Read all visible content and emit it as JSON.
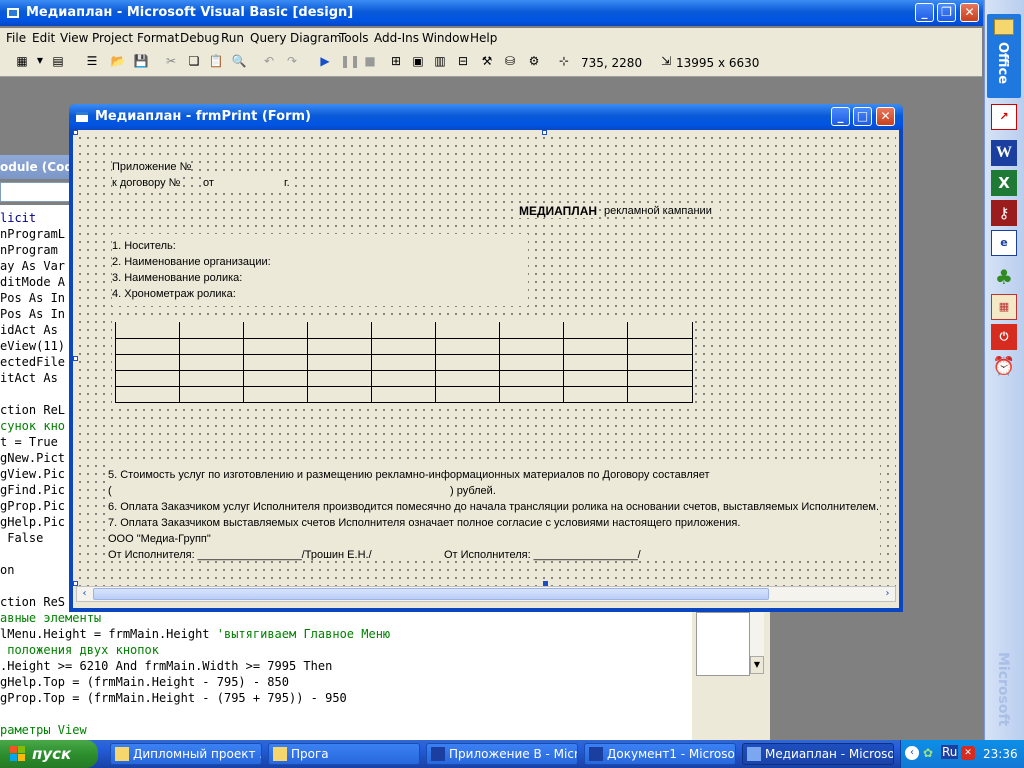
{
  "window": {
    "title": "Медиаплан - Microsoft Visual Basic [design]"
  },
  "menu": [
    "File",
    "Edit",
    "View",
    "Project",
    "Format",
    "Debug",
    "Run",
    "Query",
    "Diagram",
    "Tools",
    "Add-Ins",
    "Window",
    "Help"
  ],
  "toolbar": {
    "position": "735, 2280",
    "size": "13995 x 6630"
  },
  "code_window": {
    "title": "odule (Code)",
    "lines": [
      {
        "text": "licit",
        "kind": "blue"
      },
      {
        "text": "nProgramL",
        "kind": "plain"
      },
      {
        "text": "nProgram",
        "kind": "plain"
      },
      {
        "text": "ay As Var",
        "kind": "plain"
      },
      {
        "text": "ditMode A",
        "kind": "plain"
      },
      {
        "text": "Pos As In",
        "kind": "plain"
      },
      {
        "text": "Pos As In",
        "kind": "plain"
      },
      {
        "text": "idAct As",
        "kind": "plain"
      },
      {
        "text": "eView(11)",
        "kind": "plain"
      },
      {
        "text": "ectedFile",
        "kind": "plain"
      },
      {
        "text": "itAct As",
        "kind": "plain"
      },
      {
        "text": "",
        "kind": "plain"
      },
      {
        "text": "ction ReL",
        "kind": "plain"
      },
      {
        "text": "сунок кно",
        "kind": "green"
      },
      {
        "text": "t = True",
        "kind": "plain"
      },
      {
        "text": "gNew.Pict",
        "kind": "plain"
      },
      {
        "text": "gView.Pic",
        "kind": "plain"
      },
      {
        "text": "gFind.Pic",
        "kind": "plain"
      },
      {
        "text": "gProp.Pic",
        "kind": "plain"
      },
      {
        "text": "gHelp.Pic",
        "kind": "plain"
      },
      {
        "text": " False",
        "kind": "plain"
      },
      {
        "text": "",
        "kind": "plain"
      },
      {
        "text": "on",
        "kind": "plain"
      },
      {
        "text": "",
        "kind": "plain"
      },
      {
        "text": "ction ReS",
        "kind": "plain"
      },
      {
        "text": "авные элементы",
        "kind": "green"
      },
      {
        "text": "lMenu.Height = frmMain.Height 'вытягиваем Главное Меню",
        "kind": "mixed"
      },
      {
        "text": " положения двух кнопок",
        "kind": "green"
      },
      {
        "text": ".Height >= 6210 And frmMain.Width >= 7995 Then",
        "kind": "plain"
      },
      {
        "text": "gHelp.Top = (frmMain.Height - 795) - 850",
        "kind": "plain"
      },
      {
        "text": "gProp.Top = (frmMain.Height - (795 + 795)) - 950",
        "kind": "plain"
      },
      {
        "text": "",
        "kind": "plain"
      },
      {
        "text": "раметры View",
        "kind": "green"
      }
    ]
  },
  "form": {
    "title": "Медиаплан - frmPrint (Form)",
    "appendix_label": "Приложение №",
    "contract_label": "к договору  №",
    "from_label": "от",
    "year_label": "г.",
    "mediaplan_title": "МЕДИАПЛАН",
    "campaign_label": "рекламной кампании",
    "item1": "1. Носитель:",
    "item2": "2. Наименование организации:",
    "item3": "3. Наименование ролика:",
    "item4": "4. Хронометраж ролика:",
    "item5": "5. Стоимость услуг по изготовлению и размещению рекламно-информационных материалов по Договору составляет",
    "paren_open": "(",
    "rubles": ") рублей.",
    "item6": "6. Оплата Заказчиком услуг Исполнителя производится помесячно до начала трансляции ролика на основании счетов, выставляемых Исполнителем.",
    "item7": "7. Оплата Заказчиком выставляемых счетов Исполнителя означает полное согласие с условиями настоящего приложения.",
    "company": "ООО \"Медиа-Групп\"",
    "sign1_label": "От Исполнителя: _________________/Трошин Е.Н./",
    "sign2_label": "От Исполнителя: _________________/"
  },
  "office_bar": {
    "label": "Office",
    "brand": "Microsoft"
  },
  "taskbar": {
    "start": "пуск",
    "tasks": [
      "Дипломный проект ...",
      "Прога",
      "Приложение В - Micr...",
      "Документ1 - Microso...",
      "Медиаплан - Microso..."
    ],
    "lang": "Ru",
    "clock": "23:36"
  }
}
